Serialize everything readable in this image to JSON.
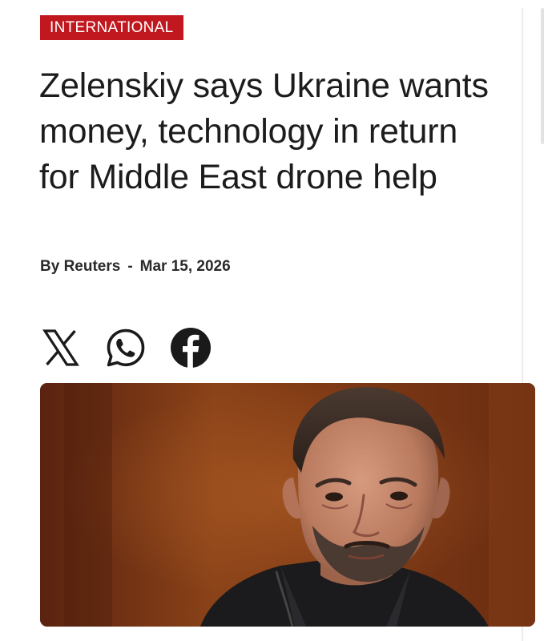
{
  "article": {
    "category": "INTERNATIONAL",
    "headline": "Zelenskiy says Ukraine wants money, technology in return for Middle East drone help",
    "byline": {
      "author": "By Reuters",
      "separator": "-",
      "date": "Mar 15, 2026"
    }
  },
  "share": {
    "items": [
      {
        "name": "x",
        "icon": "x-logo-icon"
      },
      {
        "name": "whatsapp",
        "icon": "whatsapp-icon"
      },
      {
        "name": "facebook",
        "icon": "facebook-icon"
      }
    ]
  },
  "image": {
    "subject": "man-portrait",
    "colors": {
      "background": "#7a3a16",
      "jacket": "#1b1b1d",
      "skin": "#c98a6e"
    }
  },
  "colors": {
    "accent": "#c0181e",
    "text": "#1c1c1c",
    "icon": "#1a1a1a"
  }
}
